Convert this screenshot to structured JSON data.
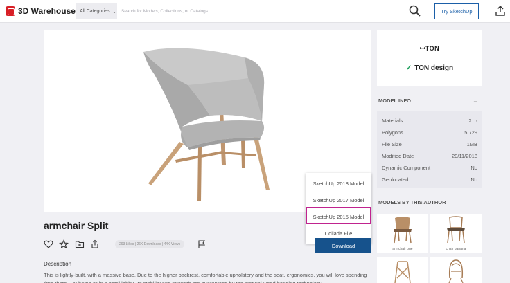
{
  "header": {
    "logo_text": "3D Warehouse",
    "category_label": "All Categories",
    "search_placeholder": "Search for Models, Collections, or Catalogs",
    "try_button": "Try SketchUp"
  },
  "model": {
    "title": "armchair Split",
    "stats": "293 Likes | 26K Downloads | 44K Views",
    "description_heading": "Description",
    "description": "This is lightly-built, with a massive base. Due to the higher backrest, comfortable upholstery and the seat, ergonomics, you will love spending time there – at home or in a hotel lobby. Its stability and strength are guaranteed by the manual wood bending technology."
  },
  "download": {
    "button_label": "Download",
    "menu_items": [
      "SketchUp 2018 Model",
      "SketchUp 2017 Model",
      "SketchUp 2015 Model",
      "Collada File"
    ],
    "highlighted_index": 2
  },
  "author": {
    "logo_text": "TON",
    "name": "TON design"
  },
  "model_info": {
    "heading": "MODEL INFO",
    "toggle": "–",
    "rows": [
      {
        "label": "Materials",
        "value": "2",
        "more": "›"
      },
      {
        "label": "Polygons",
        "value": "5,729"
      },
      {
        "label": "File Size",
        "value": "1MB"
      },
      {
        "label": "Modified Date",
        "value": "20/11/2018"
      },
      {
        "label": "Dynamic Component",
        "value": "No"
      },
      {
        "label": "Geolocated",
        "value": "No"
      }
    ]
  },
  "author_models": {
    "heading": "MODELS BY THIS AUTHOR",
    "toggle": "–",
    "items": [
      {
        "caption": "armchair one"
      },
      {
        "caption": "chair banana"
      },
      {
        "caption": ""
      },
      {
        "caption": ""
      }
    ]
  },
  "colors": {
    "brand_red": "#d81f26",
    "primary_blue": "#16528c",
    "highlight_magenta": "#c0238f"
  }
}
